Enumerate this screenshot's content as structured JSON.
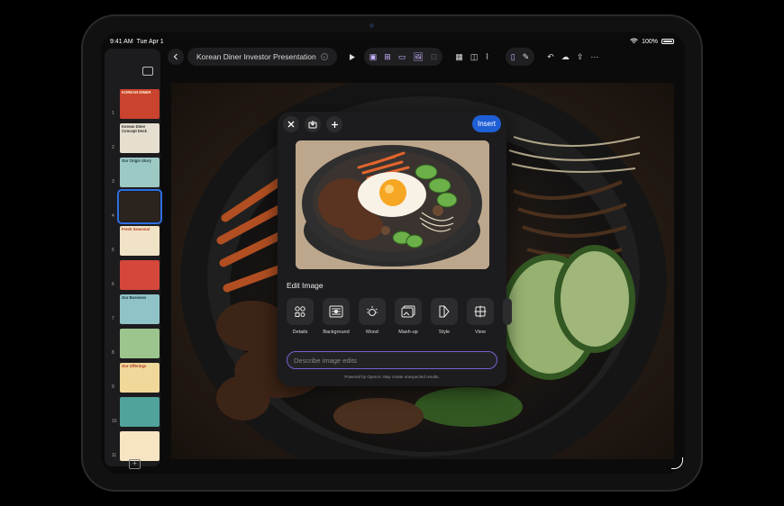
{
  "status": {
    "time": "9:41 AM",
    "date": "Tue Apr 1",
    "battery": "100%"
  },
  "document": {
    "title": "Korean Diner Investor Presentation"
  },
  "slides": [
    {
      "number": "1",
      "text": "KOREAN DINER",
      "bg": "#c9432e",
      "fg": "#fff3d6"
    },
    {
      "number": "2",
      "text": "Korean Diner Concept Deck",
      "bg": "#e6dfcf",
      "fg": "#2d2d2d"
    },
    {
      "number": "3",
      "text": "Our Origin Story",
      "bg": "#9cc9c4",
      "fg": "#1b3b3b"
    },
    {
      "number": "4",
      "text": "",
      "bg": "#2b231d",
      "fg": "#ffffff"
    },
    {
      "number": "5",
      "text": "Fresh Seasonal",
      "bg": "#f1e3c5",
      "fg": "#b3391e"
    },
    {
      "number": "6",
      "text": "",
      "bg": "#d4473a",
      "fg": "#ffffff"
    },
    {
      "number": "7",
      "text": "Our Business",
      "bg": "#8fc3c7",
      "fg": "#1d3440"
    },
    {
      "number": "8",
      "text": "",
      "bg": "#9cc58e",
      "fg": "#2b2b2b"
    },
    {
      "number": "9",
      "text": "Our Offerings",
      "bg": "#f0d79a",
      "fg": "#b3391e"
    },
    {
      "number": "10",
      "text": "",
      "bg": "#4fa39a",
      "fg": "#ffffff"
    },
    {
      "number": "11",
      "text": "",
      "bg": "#f6e4c2",
      "fg": "#333333"
    }
  ],
  "panel": {
    "insert_label": "Insert",
    "edit_label": "Edit Image",
    "tools": [
      "Details",
      "Background",
      "Mood",
      "Mash-up",
      "Style",
      "View"
    ],
    "prompt_placeholder": "Describe image edits",
    "powered_by": "Powered by OpenAI. May create unexpected results."
  },
  "colors": {
    "accent": "#1f5fd6",
    "selection": "#2f6fe4",
    "prompt_border": "#7a5fd0"
  }
}
